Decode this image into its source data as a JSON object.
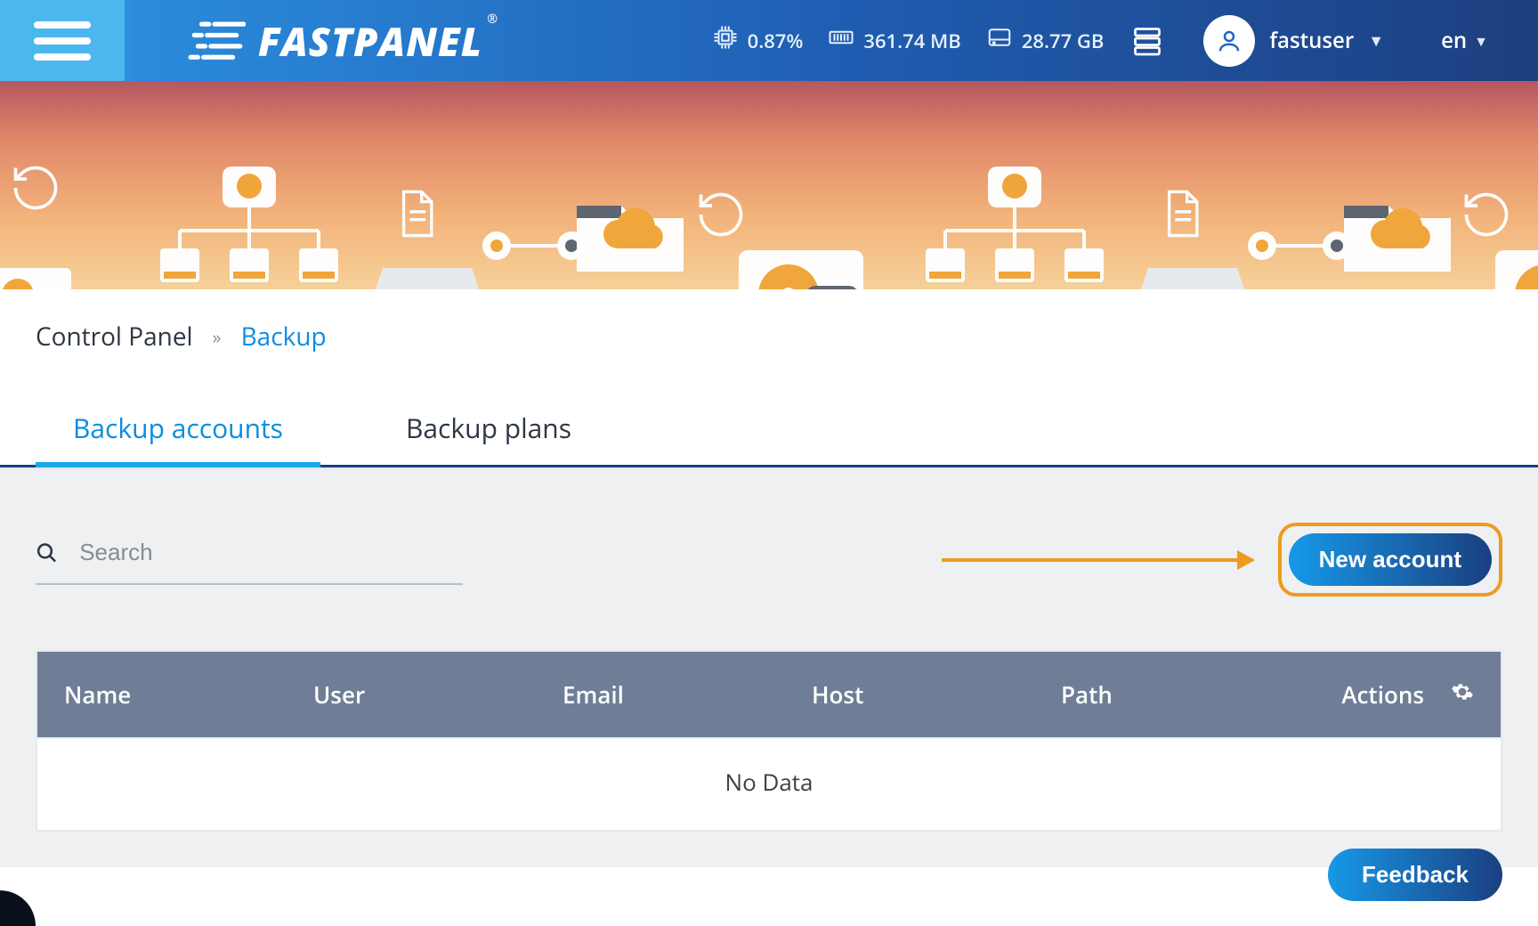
{
  "header": {
    "logo_text": "FASTPANEL",
    "logo_reg": "®",
    "cpu": "0.87%",
    "ram": "361.74 MB",
    "disk": "28.77 GB",
    "username": "fastuser",
    "lang": "en"
  },
  "breadcrumb": {
    "home": "Control Panel",
    "sep": "»",
    "current": "Backup"
  },
  "tabs": {
    "accounts": "Backup accounts",
    "plans": "Backup plans"
  },
  "toolbar": {
    "search_placeholder": "Search",
    "new_account": "New account"
  },
  "table": {
    "name": "Name",
    "user": "User",
    "email": "Email",
    "host": "Host",
    "path": "Path",
    "actions": "Actions",
    "no_data": "No Data"
  },
  "feedback": "Feedback",
  "colors": {
    "callout": "#ef9a1d",
    "accent": "#0d8de2"
  }
}
